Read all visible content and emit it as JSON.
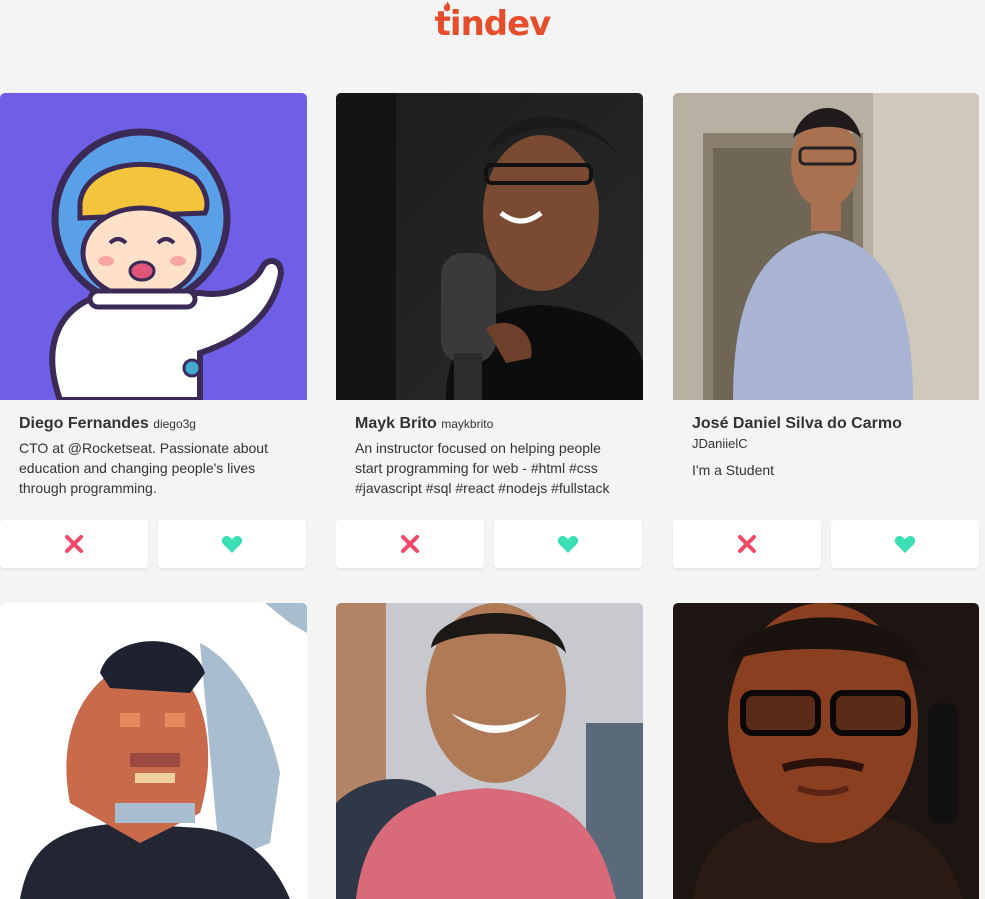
{
  "header": {
    "logo_text": "tindev"
  },
  "colors": {
    "dislike": "#f4476a",
    "like": "#3cdeb4",
    "brand": "#e54e2a"
  },
  "users": [
    {
      "name": "Diego Fernandes",
      "username": "diego3g",
      "bio": "CTO at @Rocketseat. Passionate about education and changing people's lives through programming.",
      "avatar": "astronaut-illustration"
    },
    {
      "name": "Mayk Brito",
      "username": "maykbrito",
      "bio": "An instructor focused on helping people start programming for web - #html #css #javascript #sql #react #nodejs #fullstack",
      "avatar": "photo-microphone"
    },
    {
      "name": "José Daniel Silva do Carmo",
      "username": "JDaniielC",
      "bio": "I'm a Student",
      "avatar": "photo-standing"
    },
    {
      "name": "",
      "username": "",
      "bio": "",
      "avatar": "pixel-art-portrait"
    },
    {
      "name": "",
      "username": "",
      "bio": "",
      "avatar": "photo-smiling"
    },
    {
      "name": "",
      "username": "",
      "bio": "",
      "avatar": "photo-dark-glasses"
    }
  ],
  "icons": {
    "dislike": "close-icon",
    "like": "heart-icon"
  }
}
